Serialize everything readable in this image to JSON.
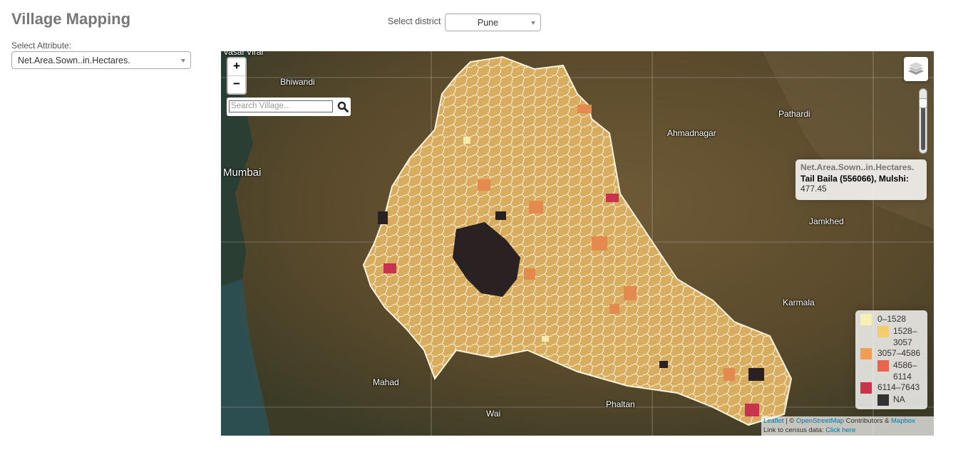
{
  "page": {
    "title": "Village Mapping",
    "attribute_label": "Select Attribute:",
    "attribute_value": "Net.Area.Sown..in.Hectares.",
    "district_label": "Select district",
    "district_value": "Pune"
  },
  "map": {
    "zoom_in": "+",
    "zoom_out": "−",
    "search_placeholder": "Search Village...",
    "search_icon": "search-icon",
    "layers_icon": "layers-icon",
    "opacity_level": 0.75,
    "places": [
      {
        "name": "Vasai Virar",
        "label": "Vasai Virar"
      },
      {
        "name": "Bhiwandi",
        "label": "Bhiwandi"
      },
      {
        "name": "Mumbai",
        "label": "Mumbai"
      },
      {
        "name": "Ahmadnagar",
        "label": "Ahmadnagar"
      },
      {
        "name": "Pathardi",
        "label": "Pathardi"
      },
      {
        "name": "Jamkhed",
        "label": "Jamkhed"
      },
      {
        "name": "Karmala",
        "label": "Karmala"
      },
      {
        "name": "Mahad",
        "label": "Mahad"
      },
      {
        "name": "Phaltan",
        "label": "Phaltan"
      },
      {
        "name": "Wai",
        "label": "Wai"
      }
    ],
    "info": {
      "title": "Net.Area.Sown..in.Hectares.",
      "village": "Tail Baila (556066), Mulshi:",
      "value": "477.45"
    },
    "legend": [
      {
        "range": "0–1528",
        "color": "#f6f0b6"
      },
      {
        "range": "1528–3057",
        "color": "#f2cc6e"
      },
      {
        "range": "3057–4586",
        "color": "#ee9f55"
      },
      {
        "range": "4586–6114",
        "color": "#e9644a"
      },
      {
        "range": "6114–7643",
        "color": "#c8334d"
      },
      {
        "range": "NA",
        "color": "#333333"
      }
    ],
    "attribution": {
      "leaflet": "Leaflet",
      "sep": "| ©",
      "osm": "OpenStreetMap",
      "contrib": "Contributors &",
      "mapbox": "Mapbox",
      "census_text": "Link to census data:",
      "census_link": "Click here"
    }
  }
}
